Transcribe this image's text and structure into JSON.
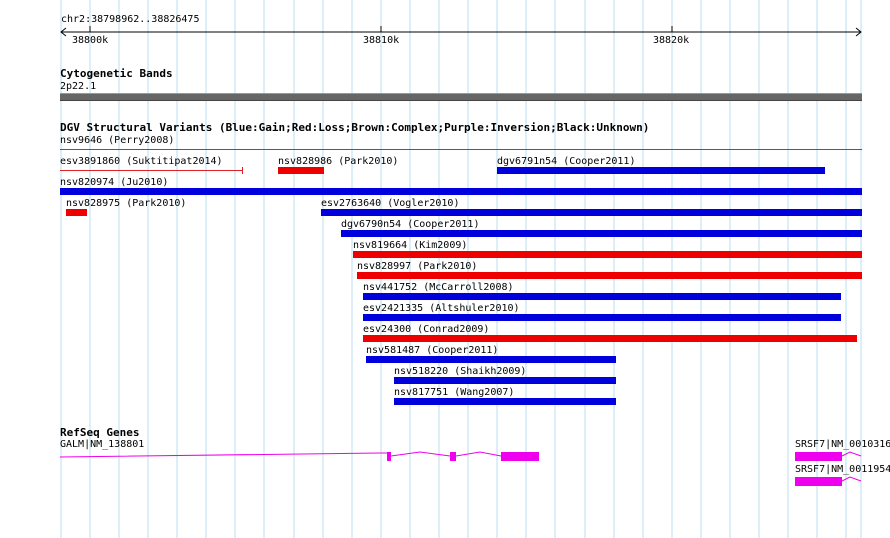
{
  "ruler": {
    "location": "chr2:38798962..38826475",
    "ticks": [
      "38800k",
      "38810k",
      "38820k"
    ]
  },
  "cyto": {
    "title": "Cytogenetic Bands",
    "band": "2p22.1"
  },
  "dgv": {
    "title": "DGV Structural Variants (Blue:Gain;Red:Loss;Brown:Complex;Purple:Inversion;Black:Unknown)",
    "colors": {
      "gain": "#0000dd",
      "loss": "#ee0000",
      "thin": "#dd2222"
    },
    "features": [
      {
        "label": "nsv9646 (Perry2008)",
        "type": "loss-line"
      },
      {
        "label": "esv3891860 (Suktitipat2014)",
        "type": "loss-line"
      },
      {
        "label": "nsv828986 (Park2010)",
        "type": "loss"
      },
      {
        "label": "dgv6791n54 (Cooper2011)",
        "type": "gain"
      },
      {
        "label": "nsv820974 (Ju2010)",
        "type": "gain"
      },
      {
        "label": "nsv828975 (Park2010)",
        "type": "loss"
      },
      {
        "label": "esv2763640 (Vogler2010)",
        "type": "gain"
      },
      {
        "label": "dgv6790n54 (Cooper2011)",
        "type": "gain"
      },
      {
        "label": "nsv819664 (Kim2009)",
        "type": "loss"
      },
      {
        "label": "nsv828997 (Park2010)",
        "type": "loss"
      },
      {
        "label": "nsv441752 (McCarroll2008)",
        "type": "gain"
      },
      {
        "label": "esv2421335 (Altshuler2010)",
        "type": "gain"
      },
      {
        "label": "esv24300 (Conrad2009)",
        "type": "loss"
      },
      {
        "label": "nsv581487 (Cooper2011)",
        "type": "gain"
      },
      {
        "label": "nsv518220 (Shaikh2009)",
        "type": "gain"
      },
      {
        "label": "nsv817751 (Wang2007)",
        "type": "gain"
      }
    ]
  },
  "refseq": {
    "title": "RefSeq Genes",
    "color": "#ee00ee",
    "genes": [
      {
        "label": "GALM|NM_138801"
      },
      {
        "label": "SRSF7|NM_0010316"
      },
      {
        "label": "SRSF7|NM_0011954"
      }
    ]
  }
}
